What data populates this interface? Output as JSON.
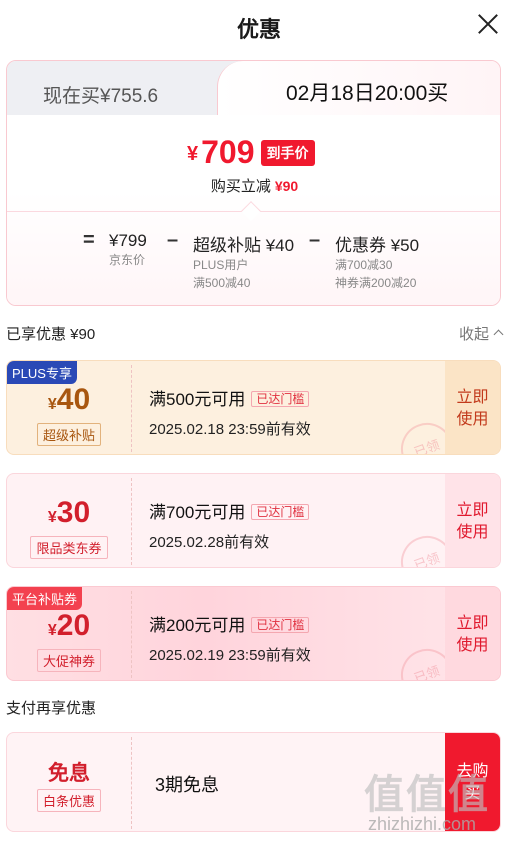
{
  "header": {
    "title": "优惠"
  },
  "tabs": {
    "now": "现在买¥755.6",
    "future": "02月18日20:00买"
  },
  "price": {
    "yen": "¥",
    "value": "709",
    "tag": "到手价",
    "instant_label": "购买立减",
    "instant_amount": "¥90"
  },
  "formula": {
    "op_eq": "=",
    "op_minus": "–",
    "jd": {
      "main": "¥799",
      "sub1": "京东价"
    },
    "subsidy": {
      "main": "超级补贴 ¥40",
      "sub1": "PLUS用户",
      "sub2": "满500减40"
    },
    "coupon": {
      "main": "优惠券 ¥50",
      "sub1": "满700减30",
      "sub2": "神券满200减20"
    }
  },
  "enjoyed": {
    "label": "已享优惠 ¥90",
    "collapse": "收起"
  },
  "coupons": [
    {
      "tag": "PLUS专享",
      "yen": "¥",
      "value": "40",
      "name": "超级补贴",
      "cond": "满500元可用",
      "badge": "已达门槛",
      "expire": "2025.02.18 23:59前有效",
      "action": "立即使用",
      "stamp": "已领"
    },
    {
      "tag": "",
      "yen": "¥",
      "value": "30",
      "name": "限品类东券",
      "cond": "满700元可用",
      "badge": "已达门槛",
      "expire": "2025.02.28前有效",
      "action": "立即使用",
      "stamp": "已领"
    },
    {
      "tag": "平台补贴券",
      "yen": "¥",
      "value": "20",
      "name": "大促神券",
      "cond": "满200元可用",
      "badge": "已达门槛",
      "expire": "2025.02.19 23:59前有效",
      "action": "立即使用",
      "stamp": "已领"
    }
  ],
  "pay": {
    "section": "支付再享优惠",
    "title": "免息",
    "name": "白条优惠",
    "desc": "3期免息",
    "action": "去购买"
  },
  "watermark": {
    "text": "值值值",
    "url": "zhizhizhi.com"
  },
  "colors": {
    "accent_red": "#f0192e",
    "plus_brown": "#a8560f",
    "plus_blue": "#2a49b6"
  }
}
